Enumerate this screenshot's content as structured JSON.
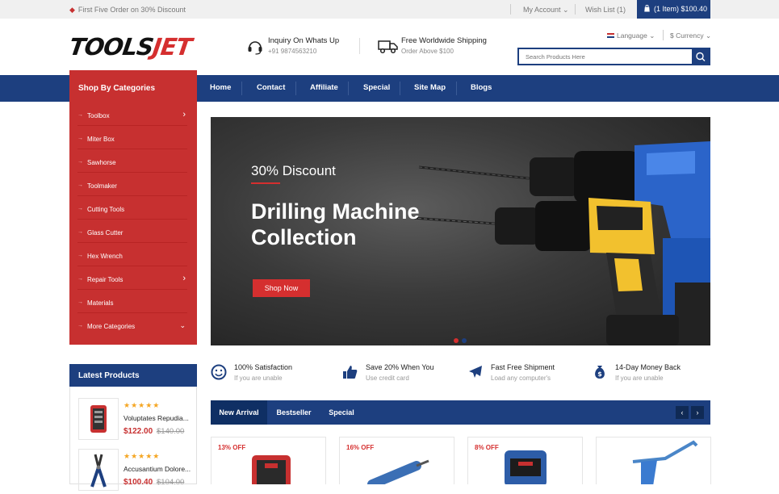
{
  "topbar": {
    "promo": "First Five Order on 30% Discount",
    "my_account": "My Account",
    "wishlist": "Wish List (1)",
    "cart": "(1 Item) $100.40"
  },
  "header": {
    "logo": {
      "prefix": "TOOLS",
      "suffix": "JET"
    },
    "info1": {
      "title": "Inquiry On Whats Up",
      "sub": "+91 9874563210",
      "icon": "headset-icon"
    },
    "info2": {
      "title": "Free Worldwide Shipping",
      "sub": "Order Above $100",
      "icon": "truck-icon"
    },
    "language": "Language",
    "currency": "$ Currency",
    "search_placeholder": "Search Products Here"
  },
  "nav": {
    "category_title": "Shop By Categories",
    "items": [
      "Home",
      "Contact",
      "Affiliate",
      "Special",
      "Site Map",
      "Blogs"
    ]
  },
  "categories": [
    {
      "label": "Toolbox",
      "has_sub": true
    },
    {
      "label": "Miter Box",
      "has_sub": false
    },
    {
      "label": "Sawhorse",
      "has_sub": false
    },
    {
      "label": "Toolmaker",
      "has_sub": false
    },
    {
      "label": "Cutting Tools",
      "has_sub": false
    },
    {
      "label": "Glass Cutter",
      "has_sub": false
    },
    {
      "label": "Hex Wrench",
      "has_sub": false
    },
    {
      "label": "Repair Tools",
      "has_sub": true
    },
    {
      "label": "Materials",
      "has_sub": false
    },
    {
      "label": "More Categories",
      "has_sub": true
    }
  ],
  "banner": {
    "discount": "30% Discount",
    "title_line1": "Drilling Machine",
    "title_line2": "Collection",
    "button": "Shop Now",
    "slide_count": 2,
    "active_slide": 1
  },
  "latest": {
    "title": "Latest Products",
    "items": [
      {
        "name": "Voluptates Repudia...",
        "price": "$122.00",
        "old": "$140.00",
        "rating": 5
      },
      {
        "name": "Accusantium Dolore...",
        "price": "$100.40",
        "old": "$104.00",
        "rating": 5
      }
    ]
  },
  "features": [
    {
      "title": "100% Satisfaction",
      "sub": "If you are unable",
      "icon": "smile-icon"
    },
    {
      "title": "Save 20% When You",
      "sub": "Use credit card",
      "icon": "thumbs-up-icon"
    },
    {
      "title": "Fast Free Shipment",
      "sub": "Load any computer's",
      "icon": "plane-icon"
    },
    {
      "title": "14-Day Money Back",
      "sub": "If you are unable",
      "icon": "money-bag-icon"
    }
  ],
  "tabs": [
    "New Arrival",
    "Bestseller",
    "Special"
  ],
  "products": [
    {
      "off": "13% OFF"
    },
    {
      "off": "16% OFF"
    },
    {
      "off": "8% OFF"
    },
    {
      "off": ""
    }
  ],
  "colors": {
    "primary": "#1d3f7f",
    "accent": "#c73030",
    "star": "#f5a623"
  }
}
